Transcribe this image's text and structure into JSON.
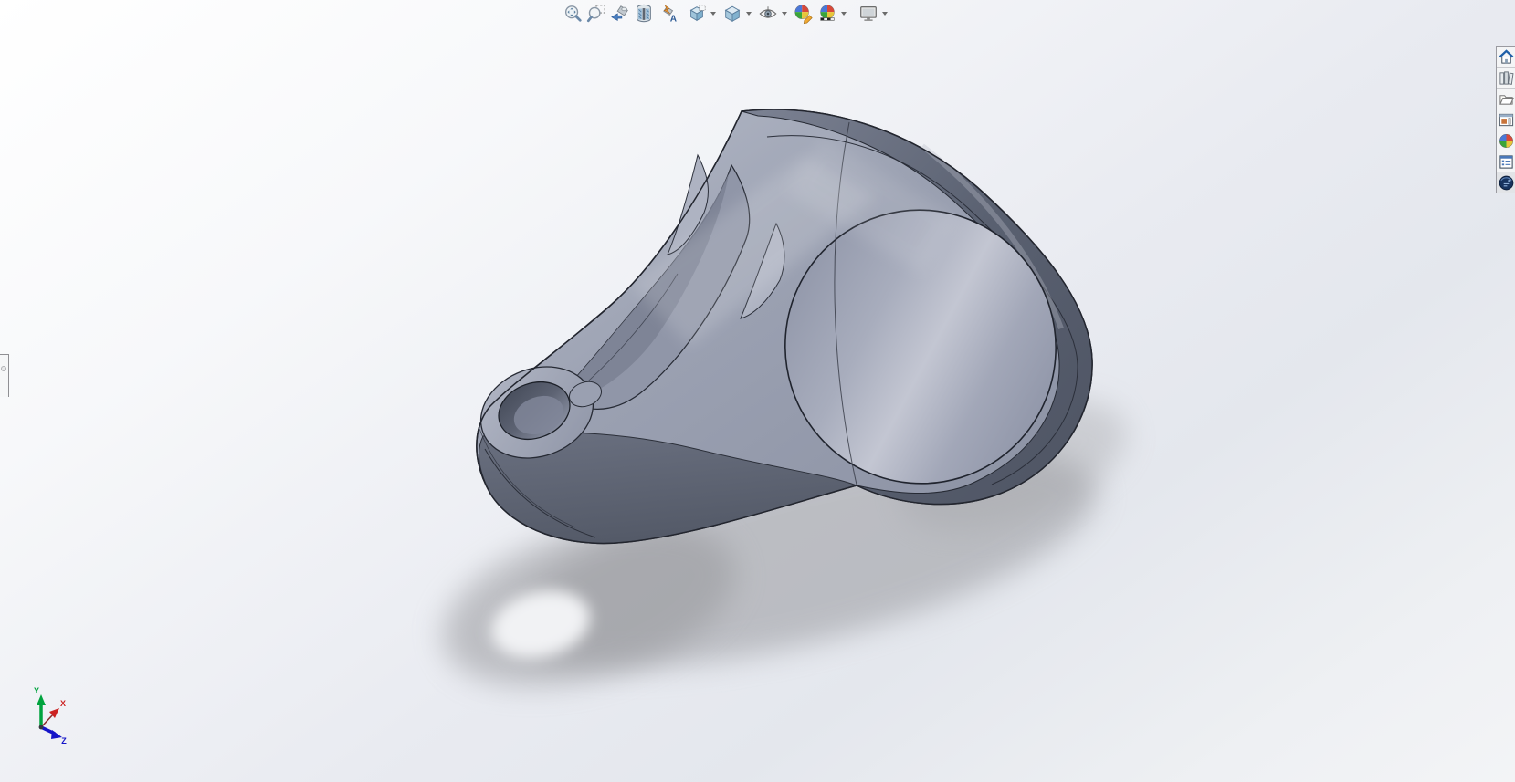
{
  "heads_up_toolbar": {
    "items": [
      {
        "name": "Zoom to Fit",
        "icon": "zoom-fit-icon",
        "has_dropdown": false
      },
      {
        "name": "Zoom to Area",
        "icon": "zoom-area-icon",
        "has_dropdown": false
      },
      {
        "name": "Previous View",
        "icon": "previous-view-icon",
        "has_dropdown": false
      },
      {
        "name": "Section View",
        "icon": "section-view-icon",
        "has_dropdown": false
      },
      {
        "name": "Dynamic Annotation Views",
        "icon": "annotation-views-icon",
        "has_dropdown": false
      },
      {
        "name": "View Orientation",
        "icon": "view-orientation-icon",
        "has_dropdown": true
      },
      {
        "name": "Display Style",
        "icon": "display-style-icon",
        "has_dropdown": true
      },
      {
        "name": "Hide/Show Items",
        "icon": "hide-show-items-icon",
        "has_dropdown": true
      },
      {
        "name": "Edit Appearance",
        "icon": "edit-appearance-icon",
        "has_dropdown": false
      },
      {
        "name": "Apply Scene",
        "icon": "apply-scene-icon",
        "has_dropdown": true
      },
      {
        "name": "View Settings",
        "icon": "view-settings-icon",
        "has_dropdown": true
      }
    ]
  },
  "task_pane": {
    "items": [
      {
        "name": "Resources Home",
        "icon": "home-icon"
      },
      {
        "name": "Design Library",
        "icon": "design-library-icon"
      },
      {
        "name": "File Explorer",
        "icon": "file-explorer-icon"
      },
      {
        "name": "View Palette",
        "icon": "view-palette-icon"
      },
      {
        "name": "Appearances, Scenes, and Decals",
        "icon": "appearances-icon"
      },
      {
        "name": "Custom Properties",
        "icon": "custom-properties-icon"
      },
      {
        "name": "Forum",
        "icon": "forum-icon"
      }
    ]
  },
  "reference_triad": {
    "x_label": "X",
    "y_label": "Y",
    "z_label": "Z",
    "x_color": "#cc2222",
    "y_color": "#00a33e",
    "z_color": "#1414c8"
  },
  "viewport": {
    "content": "3D CAD part: teardrop-shaped clamp handle with large cylindrical bore and small counterbored hole at tip",
    "colors": {
      "background_top": "#ffffff",
      "background_mid": "#e4e7ed",
      "background_bottom": "#f3f4f6",
      "part_top_face": "#a8adbd",
      "part_dark_face": "#5a6070",
      "part_rim": "#596070",
      "part_bore_face": "#a8adbd",
      "part_edge": "#23262f",
      "shadow": "#97989c"
    }
  }
}
